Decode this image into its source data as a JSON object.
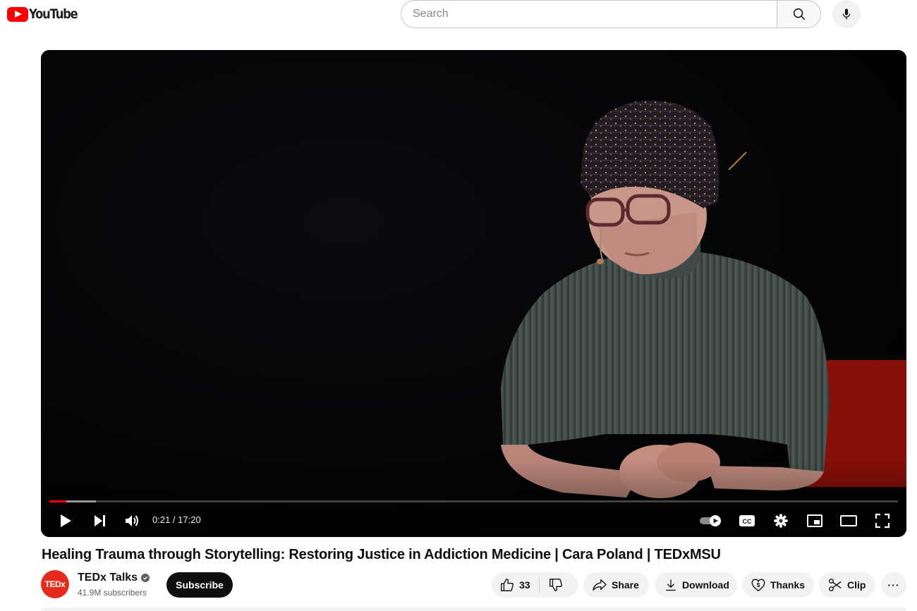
{
  "header": {
    "logo_text": "YouTube",
    "search_placeholder": "Search",
    "icons": [
      "youtube-logo-icon",
      "search-icon",
      "microphone-icon"
    ]
  },
  "player": {
    "current_time": "0:21",
    "duration": "17:20",
    "time_display": "0:21 / 17:20",
    "played_fraction": 0.02,
    "buffered_fraction": 0.055,
    "controls": [
      "play-icon",
      "next-icon",
      "volume-icon",
      "autoplay-toggle-icon",
      "captions-icon",
      "settings-icon",
      "miniplayer-icon",
      "theater-mode-icon",
      "fullscreen-icon"
    ],
    "accent_color": "#ff0000"
  },
  "video": {
    "title": "Healing Trauma through Storytelling: Restoring Justice in Addiction Medicine | Cara Poland | TEDxMSU"
  },
  "channel": {
    "avatar_text": "TEDx",
    "name": "TEDx Talks",
    "subscribers": "41.9M subscribers",
    "subscribe_label": "Subscribe"
  },
  "actions": {
    "like_count": "33",
    "share_label": "Share",
    "download_label": "Download",
    "thanks_label": "Thanks",
    "clip_label": "Clip",
    "more_label": "···"
  }
}
